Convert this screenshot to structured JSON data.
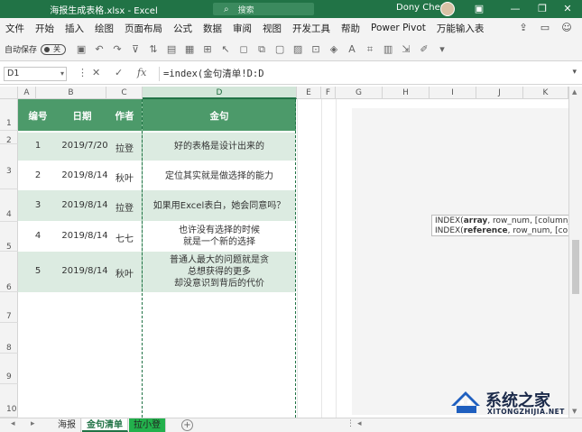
{
  "titlebar": {
    "title": "海报生成表格.xlsx - Excel",
    "search_placeholder": "搜索",
    "user": "Dony Chen",
    "minimize": "—",
    "restore": "❐",
    "close": "✕",
    "ribbon_display": "▣"
  },
  "tabs": [
    "文件",
    "开始",
    "插入",
    "绘图",
    "页面布局",
    "公式",
    "数据",
    "审阅",
    "视图",
    "开发工具",
    "帮助",
    "Power Pivot",
    "万能输入表"
  ],
  "qat": {
    "autosave_label": "自动保存",
    "toggle_label": "关"
  },
  "formula_bar": {
    "name_box": "D1",
    "cancel": "✕",
    "enter": "✓",
    "fx": "fx",
    "formula": "=index(金句清单!D:D"
  },
  "columns": [
    "A",
    "B",
    "C",
    "D",
    "E",
    "F",
    "G",
    "H",
    "I",
    "J",
    "K"
  ],
  "rows": [
    "1",
    "2",
    "3",
    "4",
    "5",
    "6",
    "7",
    "8",
    "9",
    "10"
  ],
  "table": {
    "headers": [
      "编号",
      "日期",
      "作者",
      "金句"
    ],
    "rows": [
      {
        "id": "1",
        "date": "2019/7/20",
        "author": "拉登",
        "quote": "好的表格是设计出来的"
      },
      {
        "id": "2",
        "date": "2019/8/14",
        "author": "秋叶",
        "quote": "定位其实就是做选择的能力"
      },
      {
        "id": "3",
        "date": "2019/8/14",
        "author": "拉登",
        "quote": "如果用Excel表白，她会同意吗？"
      },
      {
        "id": "4",
        "date": "2019/8/14",
        "author": "七七",
        "quote_lines": [
          "也许没有选择的时候",
          "就是一个新的选择"
        ]
      },
      {
        "id": "5",
        "date": "2019/8/14",
        "author": "秋叶",
        "quote_lines": [
          "普通人最大的问题就是贪",
          "总想获得的更多",
          "却没意识到背后的代价"
        ]
      }
    ]
  },
  "tooltip": {
    "line1_pre": "INDEX(",
    "line1_bold": "array",
    "line1_post": ", row_num, [column_num])",
    "line2_pre": "INDEX(",
    "line2_bold": "reference",
    "line2_post": ", row_num, [column_num"
  },
  "sheets": [
    "海报",
    "金句清单",
    "拉小登"
  ],
  "watermark": {
    "text": "系统之家",
    "url": "XITONGZHIJIA.NET"
  }
}
